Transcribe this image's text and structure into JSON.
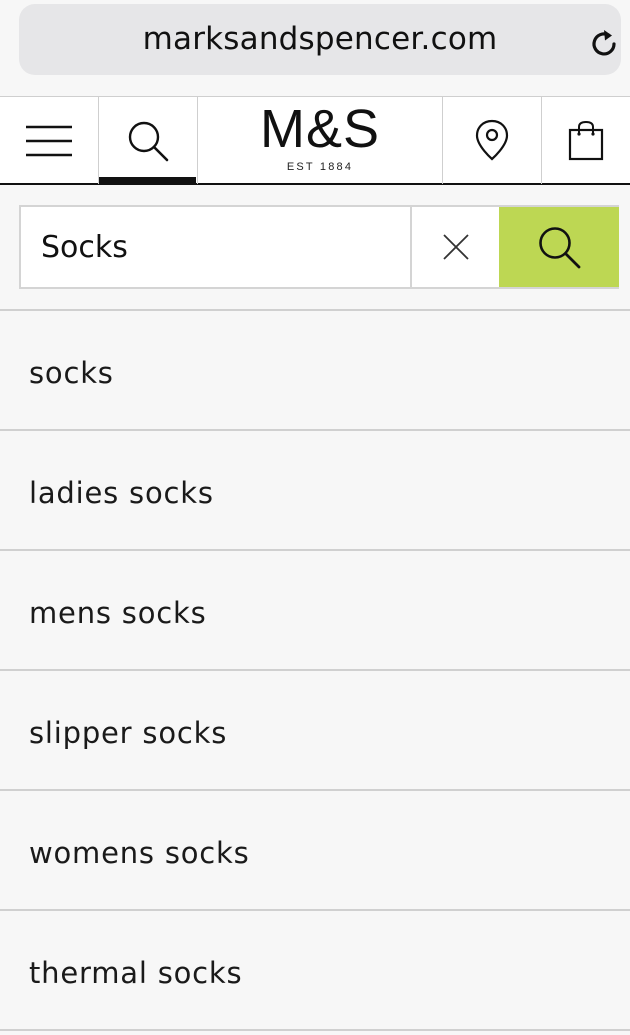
{
  "browser": {
    "url": "marksandspencer.com",
    "reload_icon": "reload-icon"
  },
  "header": {
    "menu_icon": "hamburger-menu-icon",
    "search_icon": "search-icon",
    "logo": {
      "main": "M&S",
      "sub": "EST 1884"
    },
    "store_locator_icon": "location-pin-icon",
    "bag_icon": "shopping-bag-icon"
  },
  "search": {
    "value": "Socks",
    "clear_icon": "close-icon",
    "submit_icon": "search-icon",
    "accent_color": "#bdd753"
  },
  "suggestions": [
    {
      "label": "socks"
    },
    {
      "label": "ladies socks"
    },
    {
      "label": "mens socks"
    },
    {
      "label": "slipper socks"
    },
    {
      "label": "womens socks"
    },
    {
      "label": "thermal socks"
    }
  ]
}
